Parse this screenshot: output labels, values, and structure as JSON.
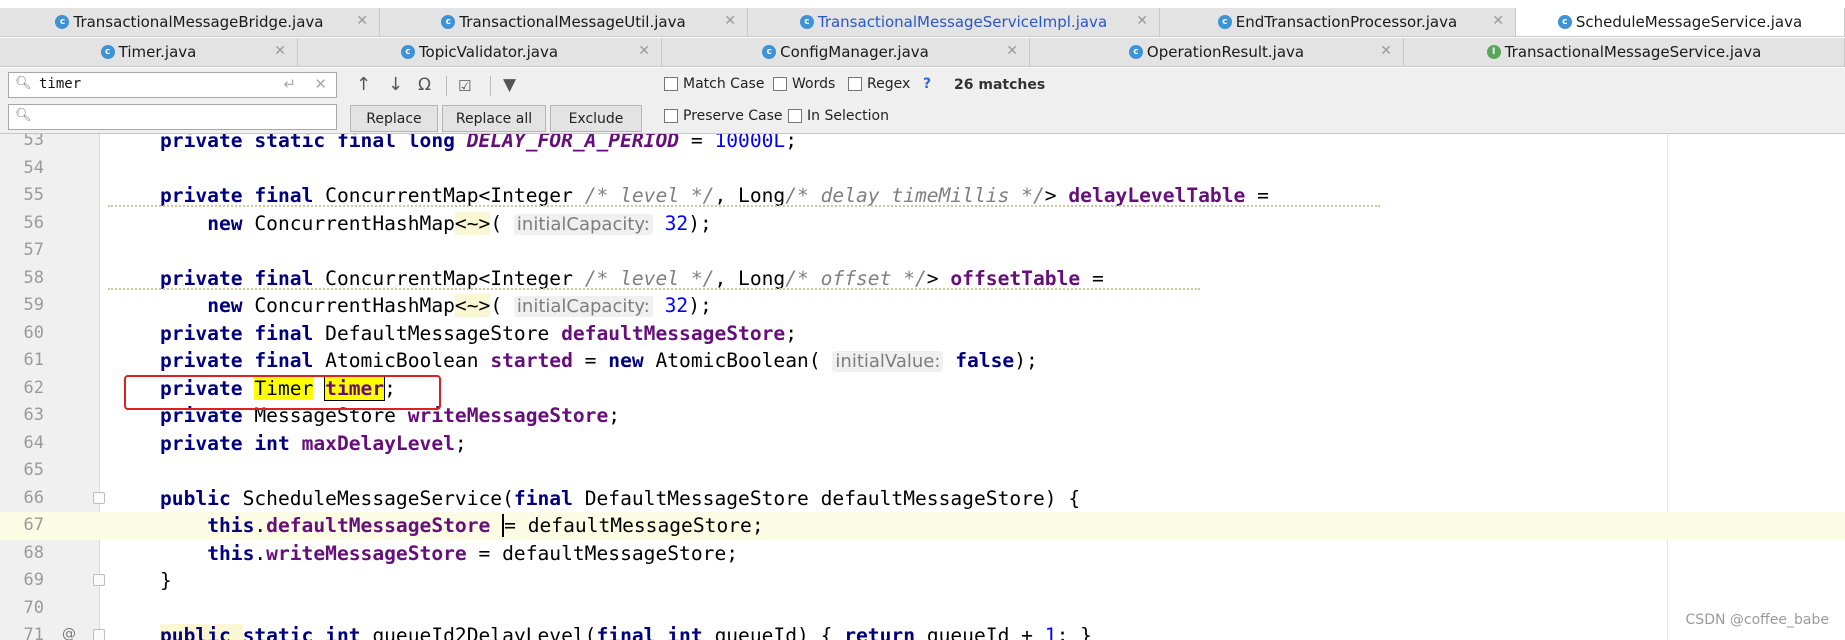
{
  "tabs_row1": [
    {
      "label": "TransactionalMessageBridge.java",
      "icon": "class-icon",
      "active": false,
      "blue": false
    },
    {
      "label": "TransactionalMessageUtil.java",
      "icon": "class-icon",
      "active": false,
      "blue": false
    },
    {
      "label": "TransactionalMessageServiceImpl.java",
      "icon": "class-icon",
      "active": false,
      "blue": true
    },
    {
      "label": "EndTransactionProcessor.java",
      "icon": "class-icon",
      "active": false,
      "blue": false
    },
    {
      "label": "ScheduleMessageService.java",
      "icon": "class-icon",
      "active": true,
      "blue": false
    }
  ],
  "tabs_row2": [
    {
      "label": "Timer.java",
      "icon": "class-icon",
      "active": false
    },
    {
      "label": "TopicValidator.java",
      "icon": "class-icon",
      "active": false
    },
    {
      "label": "ConfigManager.java",
      "icon": "class-icon",
      "active": false
    },
    {
      "label": "OperationResult.java",
      "icon": "class-icon",
      "active": false
    },
    {
      "label": "TransactionalMessageService.java",
      "icon": "interface-icon",
      "active": false
    }
  ],
  "find": {
    "query": "timer",
    "replace_value": "",
    "buttons": {
      "replace": "Replace",
      "replace_all": "Replace all",
      "exclude": "Exclude"
    },
    "options": {
      "match_case": "Match Case",
      "words": "Words",
      "regex": "Regex",
      "preserve_case": "Preserve Case",
      "in_selection": "In Selection"
    },
    "help": "?",
    "match_count": "26 matches"
  },
  "editor": {
    "current_line": 67,
    "lines": [
      {
        "n": "53",
        "html": "<span class=\"kw\">private static final long </span><span class=\"cst\">DELAY_FOR_A_PERIOD</span> = <span class=\"num\">10000L</span>;"
      },
      {
        "n": "54",
        "html": ""
      },
      {
        "n": "55",
        "html": "<span class=\"kw\">private final </span>ConcurrentMap&lt;Integer <span class=\"cmt\">/* level */</span>, Long<span class=\"cmt\">/* delay timeMillis */</span>&gt; <span class=\"fld\">delayLevelTable</span> ="
      },
      {
        "n": "56",
        "html": "    <span class=\"kw\">new </span>ConcurrentHashMap<span class=\"warn-bg\">&lt;~&gt;</span>( <span class=\"hint\">initialCapacity:</span> <span class=\"num\">32</span>);"
      },
      {
        "n": "57",
        "html": ""
      },
      {
        "n": "58",
        "html": "<span class=\"kw\">private final </span>ConcurrentMap&lt;Integer <span class=\"cmt\">/* level */</span>, Long<span class=\"cmt\">/* offset */</span>&gt; <span class=\"fld\">offsetTable</span> ="
      },
      {
        "n": "59",
        "html": "    <span class=\"kw\">new </span>ConcurrentHashMap<span class=\"warn-bg\">&lt;~&gt;</span>( <span class=\"hint\">initialCapacity:</span> <span class=\"num\">32</span>);"
      },
      {
        "n": "60",
        "html": "<span class=\"kw\">private final </span>DefaultMessageStore <span class=\"fld\">defaultMessageStore</span>;"
      },
      {
        "n": "61",
        "html": "<span class=\"kw\">private final </span>AtomicBoolean <span class=\"fld\">started</span> = <span class=\"kw\">new </span>AtomicBoolean( <span class=\"hint\">initialValue:</span> <span class=\"kw\">false</span>);"
      },
      {
        "n": "62",
        "html": "<span class=\"kw\">private </span><span class=\"hl\">Timer</span> <span class=\"fld hl-sel\">timer</span>;"
      },
      {
        "n": "63",
        "html": "<span class=\"kw\">private </span>MessageStore <span class=\"fld\">writeMessageStore</span>;"
      },
      {
        "n": "64",
        "html": "<span class=\"kw\">private int </span><span class=\"fld\">maxDelayLevel</span>;"
      },
      {
        "n": "65",
        "html": ""
      },
      {
        "n": "66",
        "html": "<span class=\"kw\">public </span>ScheduleMessageService(<span class=\"kw\">final </span>DefaultMessageStore defaultMessageStore) {"
      },
      {
        "n": "67",
        "html": "    <span class=\"kw\">this</span>.<span class=\"fld\">defaultMessageStore</span> <span class=\"caret\"></span>= defaultMessageStore;"
      },
      {
        "n": "68",
        "html": "    <span class=\"kw\">this</span>.<span class=\"fld\">writeMessageStore</span> = defaultMessageStore;"
      },
      {
        "n": "69",
        "html": "}"
      },
      {
        "n": "70",
        "html": ""
      },
      {
        "n": "71",
        "html": "<span class=\"kw warn-bg\">public </span><span class=\"kw\">static int </span>queueId2DelayLevel(<span class=\"kw\">final int </span>queueId) { <span class=\"kw\">return </span>queueId + <span class=\"num\">1</span>; }"
      }
    ]
  },
  "watermark": "CSDN @coffee_babe"
}
